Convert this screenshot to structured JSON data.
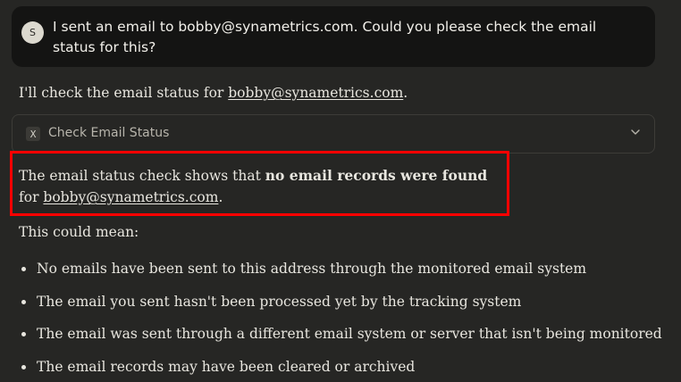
{
  "user_message": {
    "avatar_initial": "S",
    "text": "I sent an email to bobby@synametrics.com. Could you please check the email status for this?"
  },
  "reply": {
    "intro_prefix": "I'll check the email status for ",
    "intro_link": "bobby@synametrics.com",
    "intro_suffix": "."
  },
  "tool": {
    "icon_glyph": "X",
    "label": "Check Email Status"
  },
  "result": {
    "prefix": "The email status check shows that ",
    "bold": "no email records were found",
    "middle": " for ",
    "link": "bobby@synametrics.com",
    "suffix": "."
  },
  "could_mean": "This could mean:",
  "bullets": [
    "No emails have been sent to this address through the monitored email system",
    "The email you sent hasn't been processed yet by the tracking system",
    "The email was sent through a different email system or server that isn't being monitored",
    "The email records may have been cleared or archived"
  ],
  "colors": {
    "background": "#262624",
    "user_bubble": "#141413",
    "highlight": "#ff0000"
  }
}
